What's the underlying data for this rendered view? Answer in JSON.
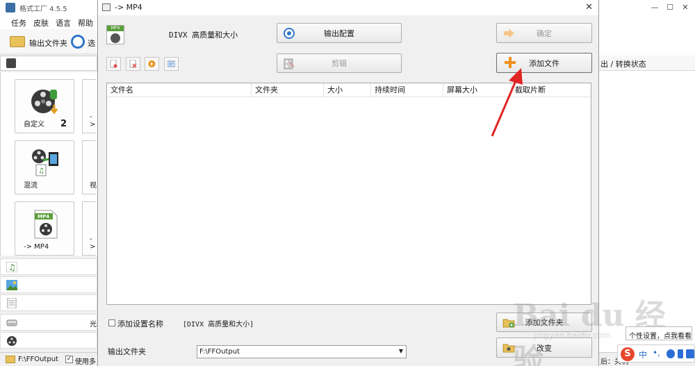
{
  "main": {
    "app_title": "格式工厂 4.5.5",
    "menu": [
      "任务",
      "皮肤",
      "语言",
      "帮助"
    ],
    "toolbar": {
      "output_folder_label": "输出文件夹",
      "options_label": "选"
    },
    "tiles": [
      {
        "label": "自定义",
        "count": "2"
      },
      {
        "label": "混流"
      },
      {
        "label": "-> MP4"
      }
    ],
    "tile_ghosts": [
      "->",
      "视",
      "->"
    ],
    "categories": {
      "disc_text": "光"
    },
    "status": {
      "path": "F:\\FFOutput",
      "use_label": "使用多",
      "check_mark": "✓"
    },
    "right": {
      "header": "出 / 转换状态",
      "status": "后：关机"
    }
  },
  "dialog": {
    "title": "-> MP4",
    "profile_name": "DIVX 高质量和大小",
    "profile_tag": "MP4",
    "buttons": {
      "output_config": "输出配置",
      "ok": "确定",
      "clip": "剪辑",
      "add_file": "添加文件",
      "add_folder": "添加文件夹",
      "change": "改变"
    },
    "table_headers": [
      "文件名",
      "文件夹",
      "大小",
      "持续时间",
      "屏幕大小",
      "截取片断"
    ],
    "add_setting_label": "添加设置名称",
    "add_setting_bracket": "[DIVX 高质量和大小]",
    "output_folder_label": "输出文件夹",
    "output_folder_value": "F:\\FFOutput"
  },
  "watermark": {
    "big": "Bai du 经验",
    "small": "jingyan.baidu.com"
  },
  "ime": {
    "tip": "个性设置，点我看看",
    "logo": "S",
    "mode": "中"
  },
  "colors": {
    "accent_orange": "#f0901e",
    "arrow_red": "#e02424",
    "ime_blue": "#2b6fd6"
  }
}
